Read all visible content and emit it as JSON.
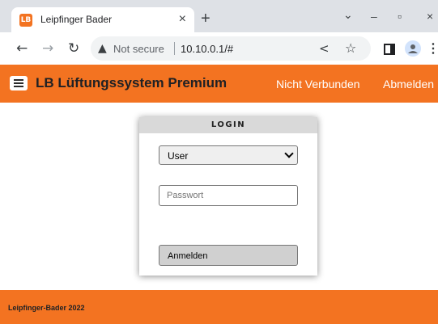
{
  "browser": {
    "tab_title": "Leipfinger Bader",
    "favicon_text": "LB",
    "close_glyph": "×",
    "new_tab_glyph": "+",
    "dropdown_glyph": "⌄",
    "minimize_glyph": "–",
    "maximize_glyph": "▫",
    "close_window_glyph": "×",
    "security_label": "Not secure",
    "url": "10.10.0.1/#",
    "icons": [
      "back-icon",
      "forward-icon",
      "reload-icon",
      "warning-icon",
      "share-icon",
      "star-icon",
      "side-panel-icon",
      "profile-icon",
      "menu-icon"
    ]
  },
  "header": {
    "title": "LB Lüftungssystem Premium",
    "status": "Nicht Verbunden",
    "logout": "Abmelden",
    "color": "#f37321"
  },
  "login": {
    "heading": "LOGIN",
    "user_select_value": "User",
    "password_placeholder": "Passwort",
    "submit_label": "Anmelden"
  },
  "footer": {
    "text": "Leipfinger-Bader 2022"
  }
}
